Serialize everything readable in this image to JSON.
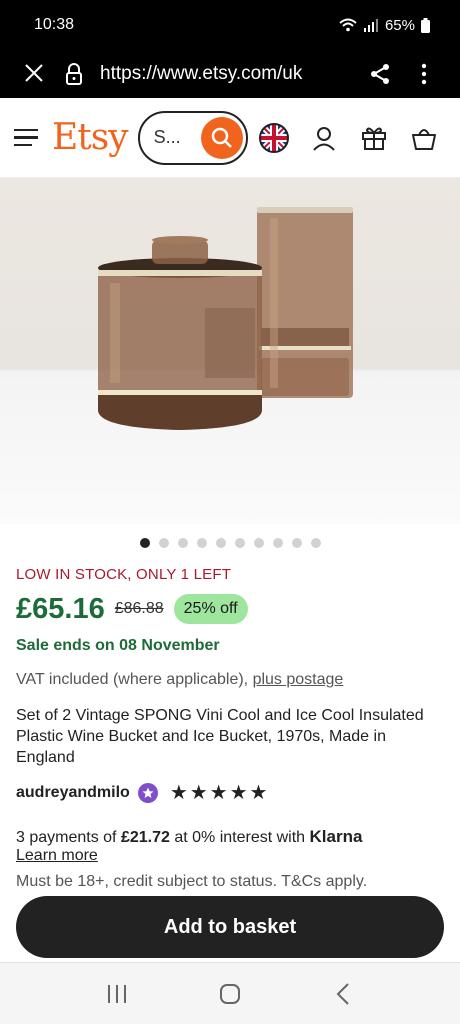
{
  "status": {
    "time": "10:38",
    "battery": "65%"
  },
  "browser": {
    "url": "https://www.etsy.com/uk"
  },
  "header": {
    "logo": "Etsy",
    "search_placeholder": "S..."
  },
  "carousel": {
    "count": 10,
    "active": 0
  },
  "product": {
    "stock": "LOW IN STOCK, ONLY 1 LEFT",
    "price": "£65.16",
    "old_price": "£86.88",
    "discount": "25% off",
    "sale_ends": "Sale ends on 08 November",
    "vat_text": "VAT included (where applicable), ",
    "postage_link": "plus postage",
    "title": "Set of 2 Vintage SPONG Vini Cool and Ice Cool Insulated Plastic Wine Bucket and Ice Bucket, 1970s, Made in England",
    "shop": "audreyandmilo",
    "rating_stars": "★★★★★",
    "rating": 5
  },
  "klarna": {
    "prefix": "3 payments of ",
    "amount": "£21.72",
    "middle": " at 0% interest with ",
    "brand": "Klarna",
    "learn_more": "Learn more",
    "credit": "Must be 18+, credit subject to status. T&Cs apply."
  },
  "actions": {
    "add_to_basket": "Add to basket"
  },
  "colors": {
    "brand": "#f1641e",
    "price": "#1e6b3a",
    "stock": "#a61a2e",
    "discount_bg": "#9ee59d",
    "star_seller": "#7f4ec8"
  },
  "icons": [
    "wifi-icon",
    "signal-icon",
    "battery-icon",
    "close-icon",
    "lock-icon",
    "share-icon",
    "more-icon",
    "menu-icon",
    "search-icon",
    "uk-flag-icon",
    "account-icon",
    "gift-icon",
    "basket-icon",
    "star-seller-icon",
    "recent-apps-icon",
    "home-icon",
    "back-icon"
  ]
}
